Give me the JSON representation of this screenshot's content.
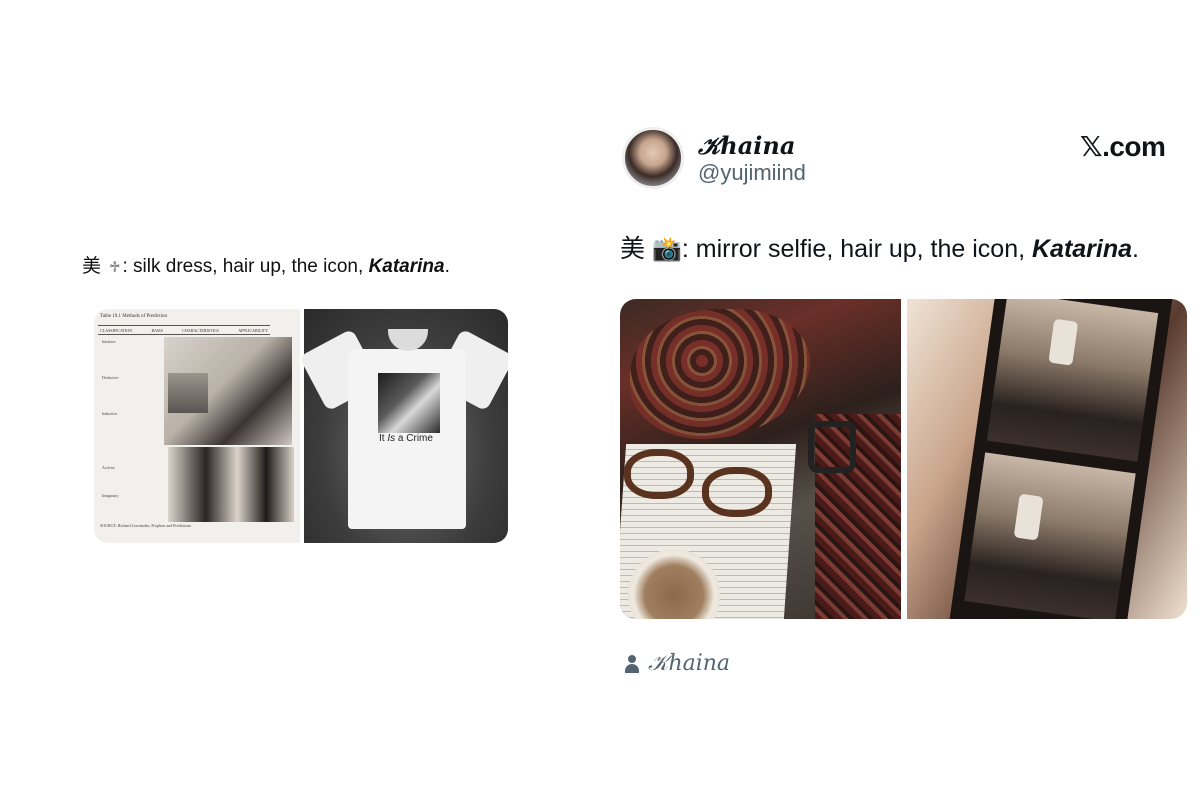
{
  "left_post": {
    "caption_prefix": "美",
    "caption_symbol": "♱",
    "caption_text": ": silk dress, hair up, the icon, ",
    "caption_emphasis": "Katarina",
    "caption_suffix": ".",
    "media": {
      "document": {
        "table_title": "Table 19.1  Methods of Prediction",
        "headers": [
          "CLASSIFICATION",
          "BASIS",
          "CHARACTERISTICS",
          "APPLICABILITY"
        ],
        "row_labels": [
          "Intuitive",
          "Deductive",
          "Inductive",
          "Activist",
          "Imaginary"
        ],
        "source": "SOURCE: Richard Lewinsohn, Prophets and Predictions"
      },
      "shirt_print": {
        "text_before": "It ",
        "text_italic": "Is",
        "text_after": " a Crime"
      }
    }
  },
  "tweet": {
    "author": {
      "display_name": "𝒦haina",
      "handle": "@yujimiind"
    },
    "brand": {
      "mark": "𝕏",
      "suffix": ".com"
    },
    "text_prefix": "美",
    "text_emoji": "📸",
    "text_body": ": mirror selfie, hair up, the icon, ",
    "text_emphasis": "Katarina",
    "text_suffix": ".",
    "footer_name": "𝒦haina"
  },
  "icons": {
    "avatar": "avatar",
    "user": "user-icon",
    "camera": "camera-emoji"
  },
  "colors": {
    "text_primary": "#0f1419",
    "text_secondary": "#536471",
    "background": "#ffffff"
  }
}
